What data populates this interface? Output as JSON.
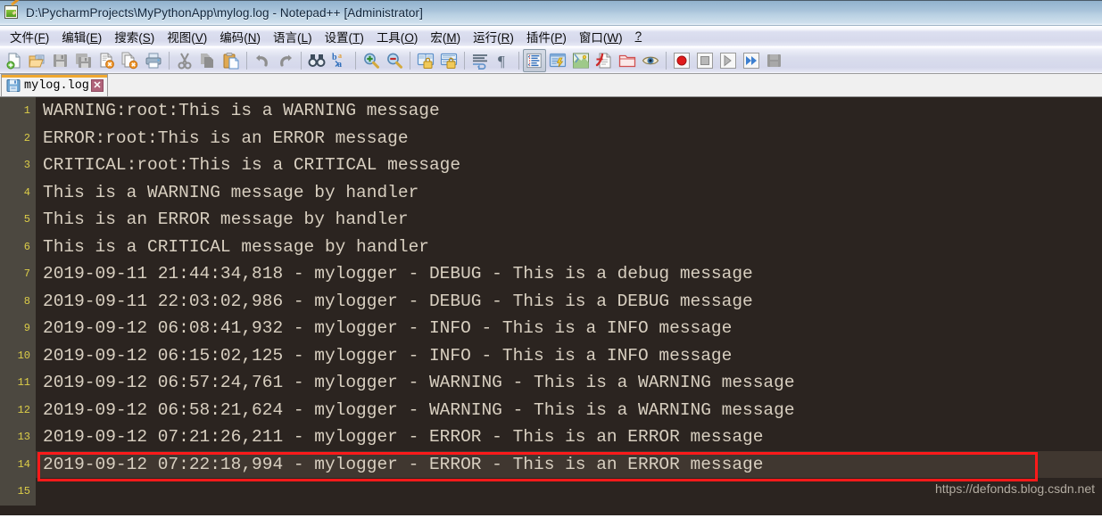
{
  "window": {
    "title": "D:\\PycharmProjects\\MyPythonApp\\mylog.log - Notepad++ [Administrator]",
    "icon": "notepad-plus-plus-icon"
  },
  "menubar": {
    "items": [
      {
        "label": "文件(F)",
        "text": "文件(",
        "accel": "F",
        "tail": ")"
      },
      {
        "label": "编辑(E)",
        "text": "编辑(",
        "accel": "E",
        "tail": ")"
      },
      {
        "label": "搜索(S)",
        "text": "搜索(",
        "accel": "S",
        "tail": ")"
      },
      {
        "label": "视图(V)",
        "text": "视图(",
        "accel": "V",
        "tail": ")"
      },
      {
        "label": "编码(N)",
        "text": "编码(",
        "accel": "N",
        "tail": ")"
      },
      {
        "label": "语言(L)",
        "text": "语言(",
        "accel": "L",
        "tail": ")"
      },
      {
        "label": "设置(T)",
        "text": "设置(",
        "accel": "T",
        "tail": ")"
      },
      {
        "label": "工具(O)",
        "text": "工具(",
        "accel": "O",
        "tail": ")"
      },
      {
        "label": "宏(M)",
        "text": "宏(",
        "accel": "M",
        "tail": ")"
      },
      {
        "label": "运行(R)",
        "text": "运行(",
        "accel": "R",
        "tail": ")"
      },
      {
        "label": "插件(P)",
        "text": "插件(",
        "accel": "P",
        "tail": ")"
      },
      {
        "label": "窗口(W)",
        "text": "窗口(",
        "accel": "W",
        "tail": ")"
      },
      {
        "label": "?",
        "text": "",
        "accel": "?",
        "tail": ""
      }
    ]
  },
  "toolbar": {
    "groups": [
      [
        "new-file-icon",
        "open-file-icon",
        "save-icon",
        "save-all-icon",
        "close-file-icon",
        "close-all-files-icon",
        "print-icon"
      ],
      [
        "cut-icon",
        "copy-icon",
        "paste-icon"
      ],
      [
        "undo-icon",
        "redo-icon"
      ],
      [
        "find-icon",
        "replace-icon"
      ],
      [
        "zoom-in-icon",
        "zoom-out-icon"
      ],
      [
        "sync-vertical-scroll-icon",
        "sync-horizontal-scroll-icon"
      ],
      [
        "word-wrap-icon",
        "show-all-characters-icon"
      ],
      [
        "indent-guide-icon",
        "user-defined-dialog-icon",
        "document-map-icon",
        "function-list-icon",
        "folder-as-workspace-icon",
        "monitoring-icon"
      ],
      [
        "macro-record-icon",
        "macro-stop-icon",
        "macro-play-icon",
        "macro-run-multiple-icon",
        "macro-save-icon"
      ]
    ]
  },
  "tabs": [
    {
      "label": "mylog.log",
      "active": true,
      "modified": false,
      "close_label": "✕"
    }
  ],
  "editor": {
    "colors": {
      "background": "#2b2420",
      "gutter_background": "#4c4840",
      "gutter_text": "#dccd48",
      "text": "#d8cfc0",
      "current_line": "#403730",
      "annotation_red": "#ff1a1a",
      "tab_accent": "#f0a830"
    },
    "current_line": 14,
    "lines": [
      {
        "n": "1",
        "text": "WARNING:root:This is a WARNING message"
      },
      {
        "n": "2",
        "text": "ERROR:root:This is an ERROR message"
      },
      {
        "n": "3",
        "text": "CRITICAL:root:This is a CRITICAL message"
      },
      {
        "n": "4",
        "text": "This is a WARNING message by handler"
      },
      {
        "n": "5",
        "text": "This is an ERROR message by handler"
      },
      {
        "n": "6",
        "text": "This is a CRITICAL message by handler"
      },
      {
        "n": "7",
        "text": "2019-09-11 21:44:34,818 - mylogger - DEBUG - This is a debug message"
      },
      {
        "n": "8",
        "text": "2019-09-11 22:03:02,986 - mylogger - DEBUG - This is a DEBUG message"
      },
      {
        "n": "9",
        "text": "2019-09-12 06:08:41,932 - mylogger - INFO - This is a INFO message"
      },
      {
        "n": "10",
        "text": "2019-09-12 06:15:02,125 - mylogger - INFO - This is a INFO message"
      },
      {
        "n": "11",
        "text": "2019-09-12 06:57:24,761 - mylogger - WARNING - This is a WARNING message"
      },
      {
        "n": "12",
        "text": "2019-09-12 06:58:21,624 - mylogger - WARNING - This is a WARNING message"
      },
      {
        "n": "13",
        "text": "2019-09-12 07:21:26,211 - mylogger - ERROR - This is an ERROR message"
      },
      {
        "n": "14",
        "text": "2019-09-12 07:22:18,994 - mylogger - ERROR - This is an ERROR message"
      },
      {
        "n": "15",
        "text": ""
      }
    ]
  },
  "annotation": {
    "target_line": "14",
    "color": "#ff1a1a"
  },
  "watermark": {
    "text": "https://defonds.blog.csdn.net"
  }
}
